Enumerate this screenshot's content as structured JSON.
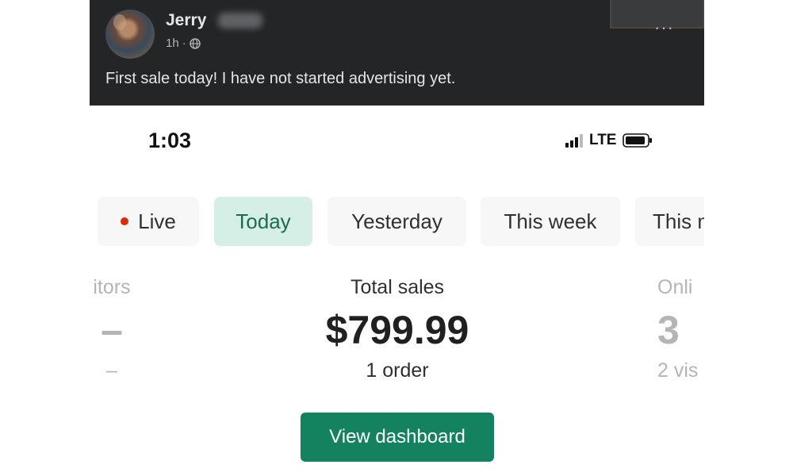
{
  "post": {
    "author": "Jerry",
    "time": "1h",
    "dot": "·",
    "more": "···",
    "text": "First sale today! I have not started advertising yet."
  },
  "status_bar": {
    "time": "1:03",
    "network": "LTE"
  },
  "filters": [
    {
      "label": "Live",
      "active": false
    },
    {
      "label": "Today",
      "active": true
    },
    {
      "label": "Yesterday",
      "active": false
    },
    {
      "label": "This week",
      "active": false
    },
    {
      "label": "This m",
      "active": false
    }
  ],
  "metrics": {
    "visitors": {
      "label": "itors",
      "value": "–",
      "sub": "–"
    },
    "total_sales": {
      "label": "Total sales",
      "value": "$799.99",
      "sub": "1 order"
    },
    "online": {
      "label": "Onli",
      "value": "3",
      "sub": "2 vis"
    }
  },
  "dashboard_button": "View dashboard",
  "colors": {
    "post_background": "#242526",
    "accent_green": "#14825f",
    "active_chip_bg": "#d5eee6",
    "live_red": "#d82c0d"
  }
}
